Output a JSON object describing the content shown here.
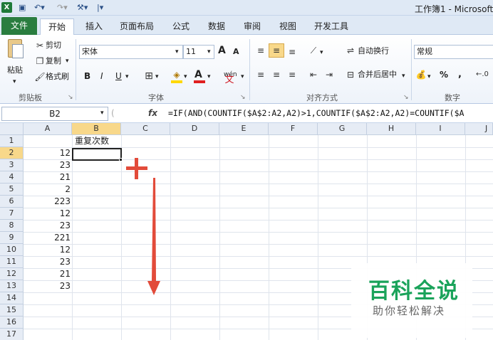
{
  "title_bar": {
    "title": "工作簿1 - Microsoft"
  },
  "tabs": [
    "文件",
    "开始",
    "插入",
    "页面布局",
    "公式",
    "数据",
    "审阅",
    "视图",
    "开发工具"
  ],
  "ribbon": {
    "clipboard": {
      "paste": "粘贴",
      "cut": "剪切",
      "copy": "复制",
      "format_painter": "格式刷",
      "label": "剪贴板"
    },
    "font": {
      "name": "宋体",
      "size": "11",
      "grow": "A",
      "shrink": "A",
      "bold": "B",
      "italic": "I",
      "underline": "U",
      "label": "字体",
      "wen": "wén"
    },
    "alignment": {
      "wrap": "自动换行",
      "merge": "合并后居中",
      "label": "对齐方式"
    },
    "number": {
      "format": "常规",
      "percent": "%",
      "comma": ",",
      "label": "数字"
    }
  },
  "formula_bar": {
    "name_box": "B2",
    "fx": "fx",
    "formula": "=IF(AND(COUNTIF($A$2:A2,A2)>1,COUNTIF($A$2:A2,A2)=COUNTIF($A"
  },
  "columns": [
    "A",
    "B",
    "C",
    "D",
    "E",
    "F",
    "G",
    "H",
    "I",
    "J"
  ],
  "rows": [
    "1",
    "2",
    "3",
    "4",
    "5",
    "6",
    "7",
    "8",
    "9",
    "10",
    "11",
    "12",
    "13",
    "14",
    "15",
    "16",
    "17"
  ],
  "cells": {
    "b1": "重复次数",
    "a_values": [
      "12",
      "23",
      "21",
      "2",
      "223",
      "12",
      "23",
      "221",
      "12",
      "23",
      "21",
      "23"
    ]
  },
  "watermark": {
    "main": "百科全说",
    "sub": "助你轻松解决"
  },
  "colors": {
    "accent_green": "#2a7d3f",
    "arrow_red": "#e24b3a",
    "selection": "#f8d88a"
  }
}
